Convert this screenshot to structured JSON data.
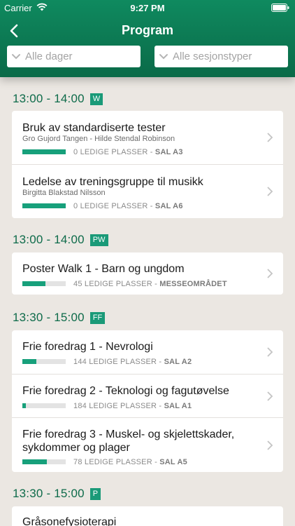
{
  "status": {
    "carrier": "Carrier",
    "time": "9:27 PM"
  },
  "header": {
    "title": "Program"
  },
  "filters": {
    "day": "Alle dager",
    "type": "Alle sesjonstyper"
  },
  "sections": [
    {
      "time": "13:00 - 14:00",
      "tag": "W",
      "items": [
        {
          "title": "Bruk av standardiserte tester",
          "speakers": "Gro Gujord Tangen - Hilde Stendal Robinson",
          "fill": 1.0,
          "seats": "0 LEDIGE PLASSER",
          "sep": " - ",
          "room": "SAL A3"
        },
        {
          "title": "Ledelse av treningsgruppe til musikk",
          "speakers": "Birgitta Blakstad Nilsson",
          "fill": 1.0,
          "seats": "0 LEDIGE PLASSER",
          "sep": " - ",
          "room": "SAL A6"
        }
      ]
    },
    {
      "time": "13:00 - 14:00",
      "tag": "PW",
      "items": [
        {
          "title": "Poster Walk 1 - Barn og ungdom",
          "fill": 0.53,
          "seats": "45 LEDIGE PLASSER",
          "sep": " - ",
          "room": "MESSEOMRÅDET"
        }
      ]
    },
    {
      "time": "13:30 - 15:00",
      "tag": "FF",
      "items": [
        {
          "title": "Frie foredrag 1 - Nevrologi",
          "fill": 0.32,
          "seats": "144 LEDIGE PLASSER",
          "sep": " - ",
          "room": "SAL A2"
        },
        {
          "title": "Frie foredrag 2 - Teknologi og fagutøvelse",
          "fill": 0.08,
          "seats": "184 LEDIGE PLASSER",
          "sep": " - ",
          "room": "SAL A1"
        },
        {
          "title": "Frie foredrag 3 - Muskel- og skjelettskader, sykdommer og plager",
          "fill": 0.56,
          "seats": "78 LEDIGE PLASSER",
          "sep": " - ",
          "room": "SAL A5"
        }
      ]
    },
    {
      "time": "13:30 - 15:00",
      "tag": "P",
      "items": [
        {
          "title": "Gråsonefysioterapi"
        }
      ]
    }
  ],
  "colors": {
    "header": "#0f8a5f",
    "accent": "#17a07b",
    "time": "#0e6b4a",
    "background": "#ebe7e2"
  },
  "icons": {
    "back": "chevron-left-icon",
    "filter": "chevron-down-icon",
    "row": "chevron-right-icon",
    "wifi": "wifi-icon",
    "battery": "battery-icon"
  }
}
